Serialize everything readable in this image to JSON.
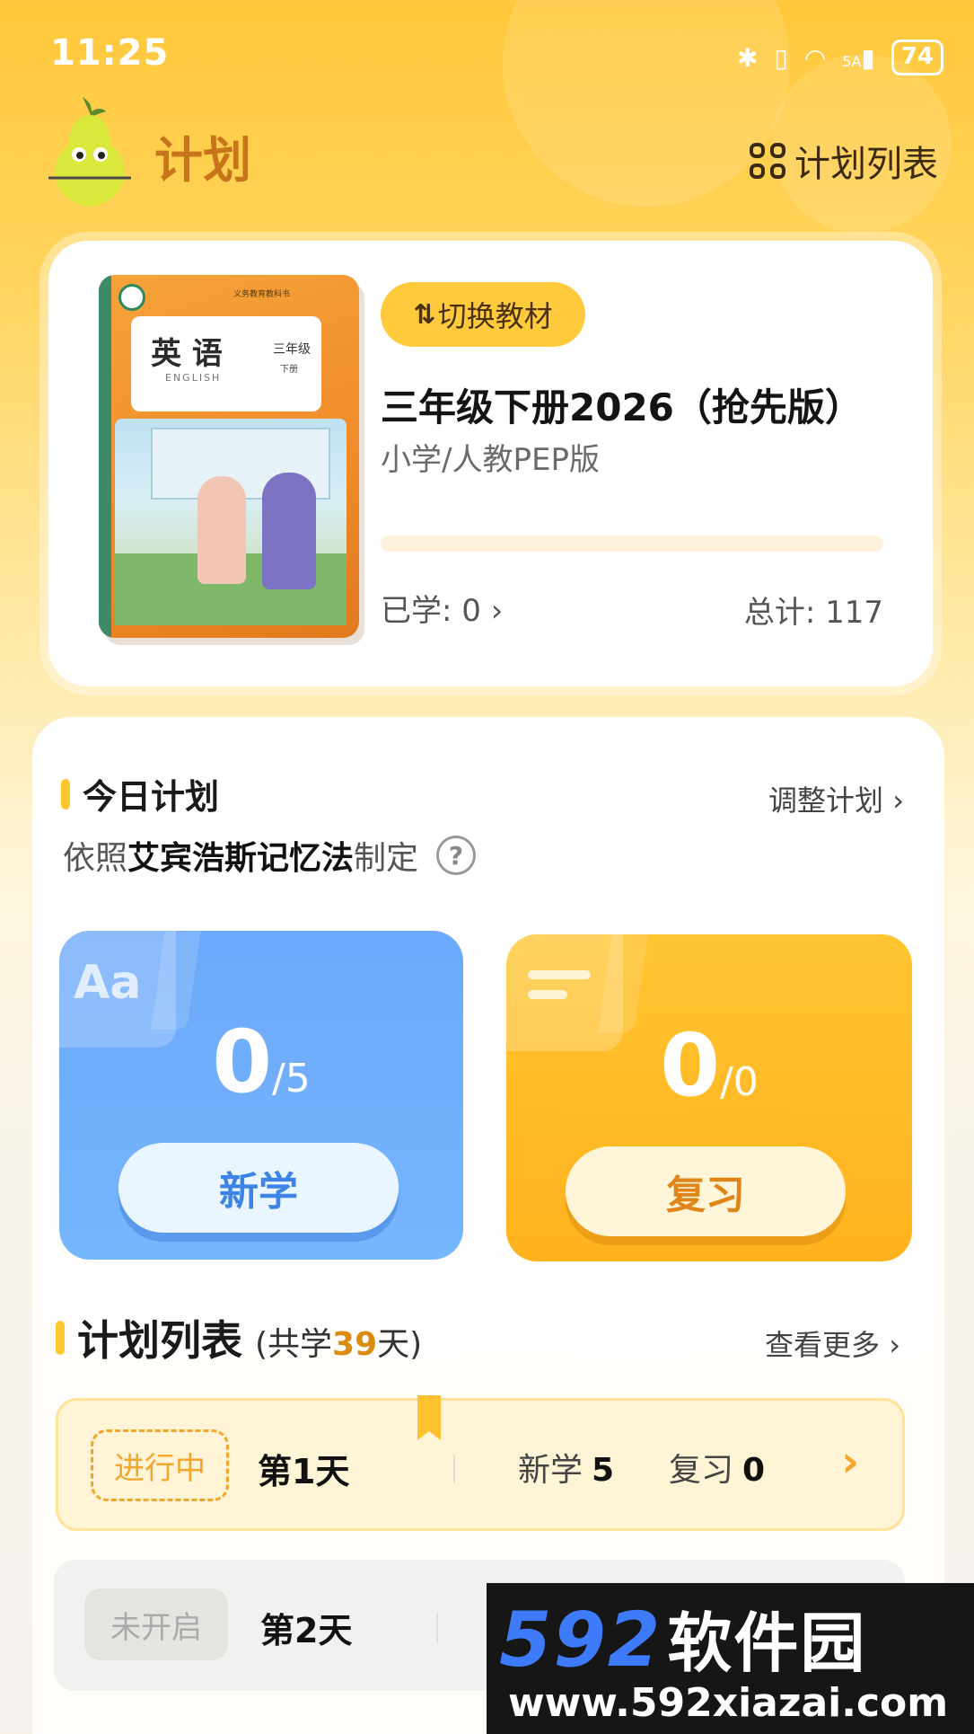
{
  "status_bar": {
    "time": "11:25",
    "icons": [
      "bluetooth-icon",
      "vibrate-icon",
      "wifi-icon",
      "signal-5g-icon"
    ],
    "signal_label": "5A",
    "battery": "74"
  },
  "header": {
    "title": "计划",
    "plan_list_label": "计划列表"
  },
  "book": {
    "switch_label": "切换教材",
    "title": "三年级下册2026（抢先版）",
    "edition": "小学/人教PEP版",
    "cover": {
      "title": "英 语",
      "subtitle": "ENGLISH",
      "grade": "三年级",
      "term": "下册",
      "publisher_top": "义务教育教科书"
    },
    "progress": 0,
    "learned_label": "已学: 0",
    "total_label": "总计: 117"
  },
  "today": {
    "title": "今日计划",
    "adjust_label": "调整计划",
    "method_prefix": "依照",
    "method_bold": "艾宾浩斯记忆法",
    "method_suffix": "制定",
    "help_symbol": "?",
    "new": {
      "glyph": "Aa",
      "done": "0",
      "total": "/5",
      "button": "新学"
    },
    "review": {
      "done": "0",
      "total": "/0",
      "button": "复习"
    }
  },
  "plan_list": {
    "title": "计划列表",
    "sub_prefix": "(共学",
    "days": "39",
    "sub_suffix": "天)",
    "more_label": "查看更多",
    "rows": [
      {
        "status": "进行中",
        "day": "第1天",
        "new_label": "新学",
        "new_count": "5",
        "review_label": "复习",
        "review_count": "0"
      },
      {
        "status": "未开启",
        "day": "第2天"
      }
    ]
  },
  "watermark": {
    "brand": "592",
    "brand_cn": "软件园",
    "url": "www.592xiazai.com"
  },
  "colors": {
    "accent": "#FFC82E",
    "brand_orange": "#C8741A",
    "new_blue": "#6CA8FA",
    "review_yellow": "#FFB21E"
  }
}
